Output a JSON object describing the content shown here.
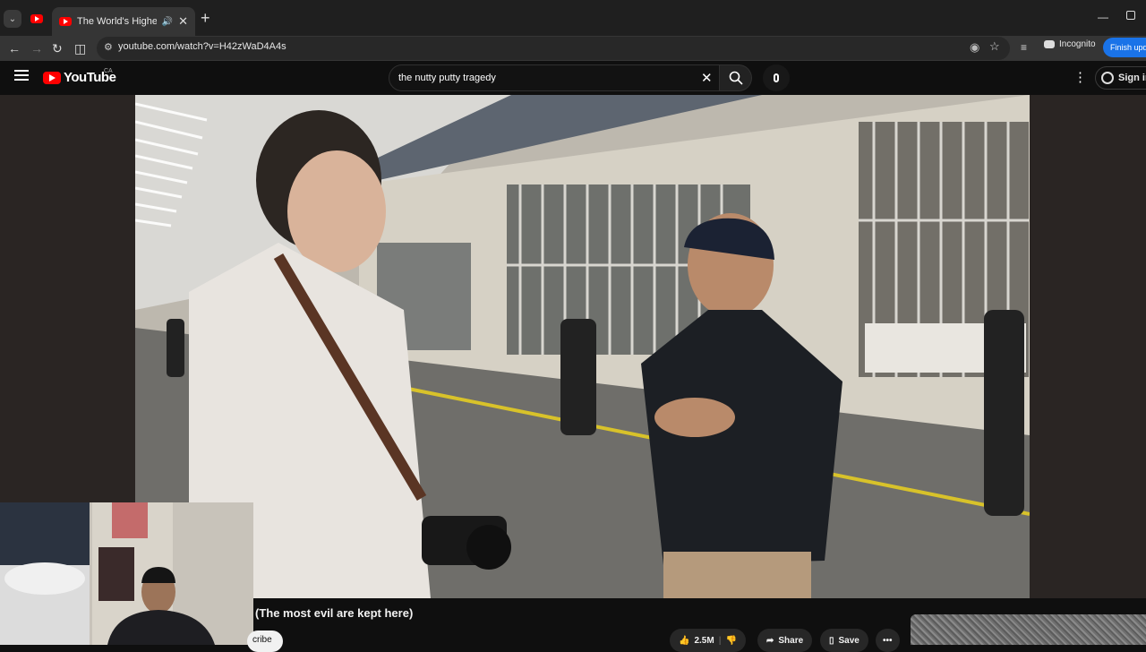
{
  "browser": {
    "tab_title": "The World's Highest Securi",
    "url": "youtube.com/watch?v=H42zWaD4A4s",
    "incognito_label": "Incognito",
    "update_label": "Finish upda"
  },
  "youtube": {
    "logo_text": "YouTube",
    "region": "CA",
    "search_query": "the nutty putty tragedy",
    "signin_label": "Sign in"
  },
  "video": {
    "title_visible": "(The most evil are kept here)",
    "subscribe_partial": "cribe",
    "likes": "2.5M",
    "share_label": "Share",
    "save_label": "Save",
    "more_label": "•••"
  },
  "colors": {
    "yt_red": "#ff0000",
    "bg": "#0f0f0f",
    "chip": "#272727",
    "incognito_update": "#1a73e8"
  }
}
